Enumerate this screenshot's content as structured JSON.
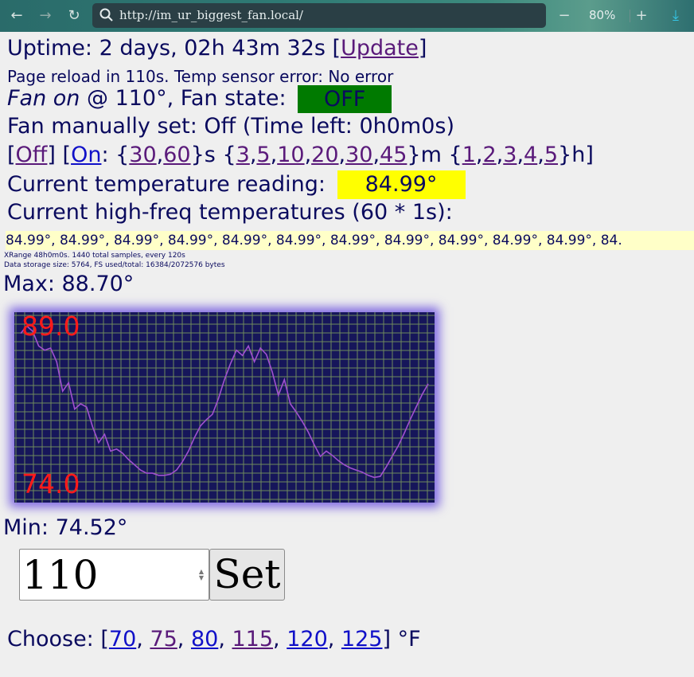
{
  "browser": {
    "url": "http://im_ur_biggest_fan.local/",
    "zoom": "80%"
  },
  "uptime": {
    "prefix": "Uptime: 2 days, 02h 43m 32s [",
    "link": "Update",
    "suffix": "]"
  },
  "status_line": "Page reload in 110s. Temp sensor error: No error",
  "fan_on": {
    "label_italic": "Fan on",
    "rest": " @ 110°, Fan state: ",
    "state": "OFF",
    "state_color": "#007a00"
  },
  "manual": "Fan manually set: Off (Time left: 0h0m0s)",
  "controls": {
    "off": "Off",
    "on": "On",
    "seconds": [
      "30",
      "60"
    ],
    "minutes": [
      "3",
      "5",
      "10",
      "20",
      "30",
      "45"
    ],
    "hours": [
      "1",
      "2",
      "3",
      "4",
      "5"
    ],
    "s_unit": "s",
    "m_unit": "m",
    "h_unit": "h"
  },
  "current_temp": {
    "label": "Current temperature reading: ",
    "value": "84.99°",
    "highlight": "#ffff00"
  },
  "hf_label": "Current high-freq temperatures (60 * 1s):",
  "hf_values": "84.99°, 84.99°, 84.99°, 84.99°, 84.99°, 84.99°, 84.99°, 84.99°, 84.99°, 84.99°, 84.99°, 84.",
  "xrange": "XRange 48h0m0s. 1440 total samples, every 120s",
  "storage": "Data storage size: 5764, FS used/total: 16384/2072576 bytes",
  "max": "Max: 88.70°",
  "min": "Min: 74.52°",
  "chart_data": {
    "type": "line",
    "top_label": "89.0",
    "bottom_label": "74.0",
    "ylim": [
      74.0,
      89.0
    ],
    "grid": true,
    "line_color": "#a050d0",
    "y": [
      88.2,
      88.9,
      88.4,
      87.0,
      86.6,
      86.8,
      85.5,
      82.7,
      83.5,
      81.0,
      81.5,
      81.2,
      79.3,
      77.8,
      78.6,
      77.0,
      77.2,
      76.8,
      76.2,
      75.7,
      75.2,
      74.9,
      74.9,
      74.7,
      74.7,
      74.8,
      75.2,
      76.0,
      77.0,
      78.3,
      79.4,
      80.0,
      80.5,
      82.0,
      83.8,
      85.3,
      86.6,
      86.1,
      87.0,
      85.5,
      86.8,
      86.2,
      84.5,
      82.3,
      83.8,
      81.5,
      80.7,
      79.8,
      78.8,
      77.6,
      76.5,
      77.0,
      76.6,
      76.1,
      75.7,
      75.4,
      75.2,
      75.0,
      74.7,
      74.5,
      74.6,
      75.5,
      76.5,
      77.5,
      78.7,
      80.0,
      81.2,
      82.4,
      83.4
    ],
    "xlabel": "",
    "ylabel": ""
  },
  "setpoint": {
    "value": "110",
    "button": "Set"
  },
  "choose": {
    "prefix": "Choose: [",
    "options": [
      "70",
      "75",
      "80",
      "115",
      "120",
      "125"
    ],
    "suffix": "] °F"
  }
}
